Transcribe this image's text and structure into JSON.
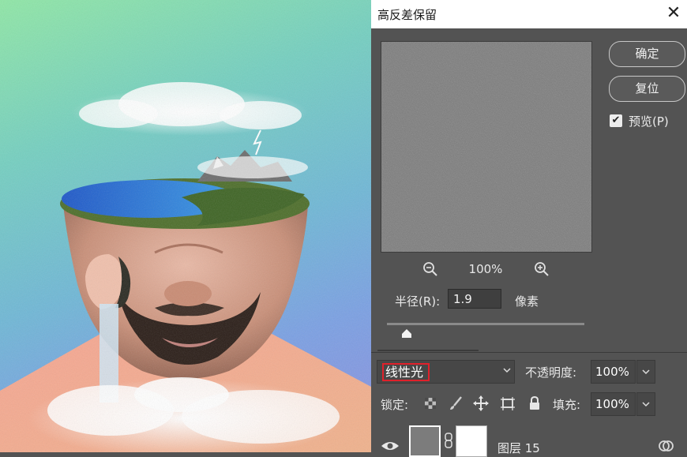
{
  "dialog": {
    "title": "高反差保留",
    "ok_label": "确定",
    "reset_label": "复位",
    "preview_label": "预览(P)",
    "preview_checked": true,
    "zoom": "100%",
    "radius_label": "半径(R):",
    "radius_value": "1.9",
    "unit_label": "像素",
    "slider_fraction": 0.1
  },
  "layers": {
    "blend_mode": "线性光",
    "opacity_label": "不透明度:",
    "opacity_value": "100%",
    "lock_label": "锁定:",
    "fill_label": "填充:",
    "fill_value": "100%",
    "layer_name": "图层 15"
  },
  "icons": [
    "close-icon",
    "zoom-out-icon",
    "zoom-in-icon",
    "checkmark-icon",
    "slider-thumb-icon",
    "chevron-down-icon",
    "lock-transparent-icon",
    "lock-brush-icon",
    "lock-move-icon",
    "lock-artboard-icon",
    "lock-all-icon",
    "eye-icon",
    "chain-link-icon",
    "smart-object-icon"
  ],
  "colors": {
    "panel_bg": "#535353",
    "highlight_border": "#e0212b",
    "preview_gray": "#7a7a7a"
  }
}
